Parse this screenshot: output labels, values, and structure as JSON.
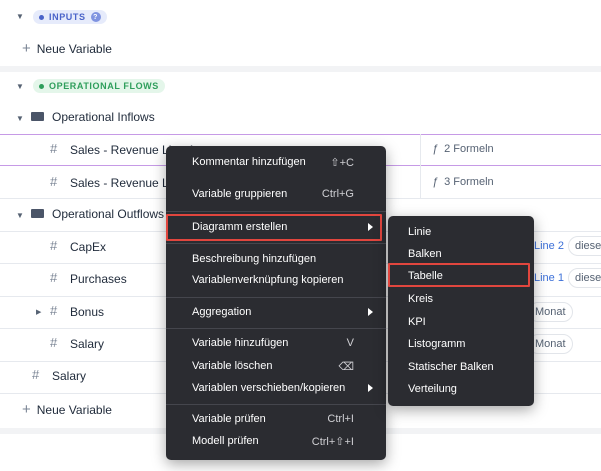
{
  "sections": {
    "inputs": {
      "badge": "INPUTS",
      "add_label": "Neue Variable",
      "help_icon": "?"
    },
    "flows": {
      "badge": "OPERATIONAL FLOWS",
      "add_label": "Neue Variable"
    }
  },
  "tree": {
    "inflows": "Operational Inflows",
    "revenue1": "Sales - Revenue Line 1",
    "revenue2": "Sales - Revenue Line 2",
    "outflows": "Operational Outflows",
    "capex": "CapEx",
    "purchases": "Purchases",
    "bonus": "Bonus",
    "salary_child": "Salary",
    "salary": "Salary"
  },
  "formulas": {
    "row1": "2 Formeln",
    "row2": "3 Formeln",
    "glyph": "ƒ"
  },
  "chips": {
    "capex_link": "Line 2",
    "capex_extra": "dieser",
    "purch_link": "Line 1",
    "purch_extra": "dieser",
    "bonus_chip": "Monat",
    "salary_chip": "Monat"
  },
  "context_menu": {
    "comment": "Kommentar hinzufügen",
    "comment_sc": "⇧+C",
    "group": "Variable gruppieren",
    "group_sc": "Ctrl+G",
    "chart": "Diagramm erstellen",
    "desc": "Beschreibung hinzufügen",
    "copy_link": "Variablenverknüpfung kopieren",
    "aggregation": "Aggregation",
    "add_var": "Variable hinzufügen",
    "add_var_sc": "V",
    "delete_var": "Variable löschen",
    "delete_var_sc": "⌫",
    "move_var": "Variablen verschieben/kopieren",
    "check_var": "Variable prüfen",
    "check_var_sc": "Ctrl+I",
    "check_model": "Modell prüfen",
    "check_model_sc": "Ctrl+⇧+I"
  },
  "submenu": [
    "Linie",
    "Balken",
    "Tabelle",
    "Kreis",
    "KPI",
    "Listogramm",
    "Statischer Balken",
    "Verteilung"
  ],
  "colors": {
    "inputs_badge_bg": "#e6ebfb",
    "inputs_badge_fg": "#4a63c9",
    "flows_badge_bg": "#e4f6ea",
    "flows_badge_fg": "#2e9e5b",
    "menu_bg": "#2b2c31",
    "highlight": "#e1463e",
    "selected_row": "#c69ae6"
  }
}
